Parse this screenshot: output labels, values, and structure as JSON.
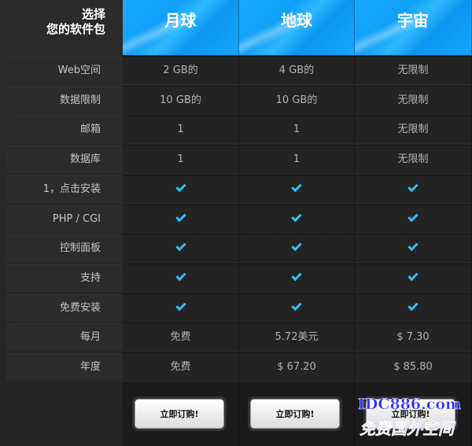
{
  "header": {
    "corner_line1": "选择",
    "corner_line2": "您的软件包",
    "plans": [
      "月球",
      "地球",
      "宇宙"
    ]
  },
  "rows": [
    {
      "label": "Web空间",
      "values": [
        "2 GB的",
        "4 GB的",
        "无限制"
      ]
    },
    {
      "label": "数据限制",
      "values": [
        "10 GB的",
        "10 GB的",
        "无限制"
      ]
    },
    {
      "label": "邮箱",
      "values": [
        "1",
        "1",
        "无限制"
      ]
    },
    {
      "label": "数据库",
      "values": [
        "1",
        "1",
        "无限制"
      ]
    },
    {
      "label": "1，点击安装",
      "values": [
        "check",
        "check",
        "check"
      ]
    },
    {
      "label": "PHP / CGI",
      "values": [
        "check",
        "check",
        "check"
      ]
    },
    {
      "label": "控制面板",
      "values": [
        "check",
        "check",
        "check"
      ]
    },
    {
      "label": "支持",
      "values": [
        "check",
        "check",
        "check"
      ]
    },
    {
      "label": "免费安装",
      "values": [
        "check",
        "check",
        "check"
      ]
    },
    {
      "label": "每月",
      "values": [
        "免费",
        "5.72美元",
        "$ 7.30"
      ]
    },
    {
      "label": "年度",
      "values": [
        "免费",
        "$ 67.20",
        "$ 85.80"
      ]
    }
  ],
  "buttons": {
    "order_label": "立即订购!"
  },
  "watermark": {
    "line1": "IDC886.com",
    "line2": "免费国外空间"
  },
  "colors": {
    "header_blue": "#19a9ff",
    "check_blue": "#2ec0f3"
  }
}
